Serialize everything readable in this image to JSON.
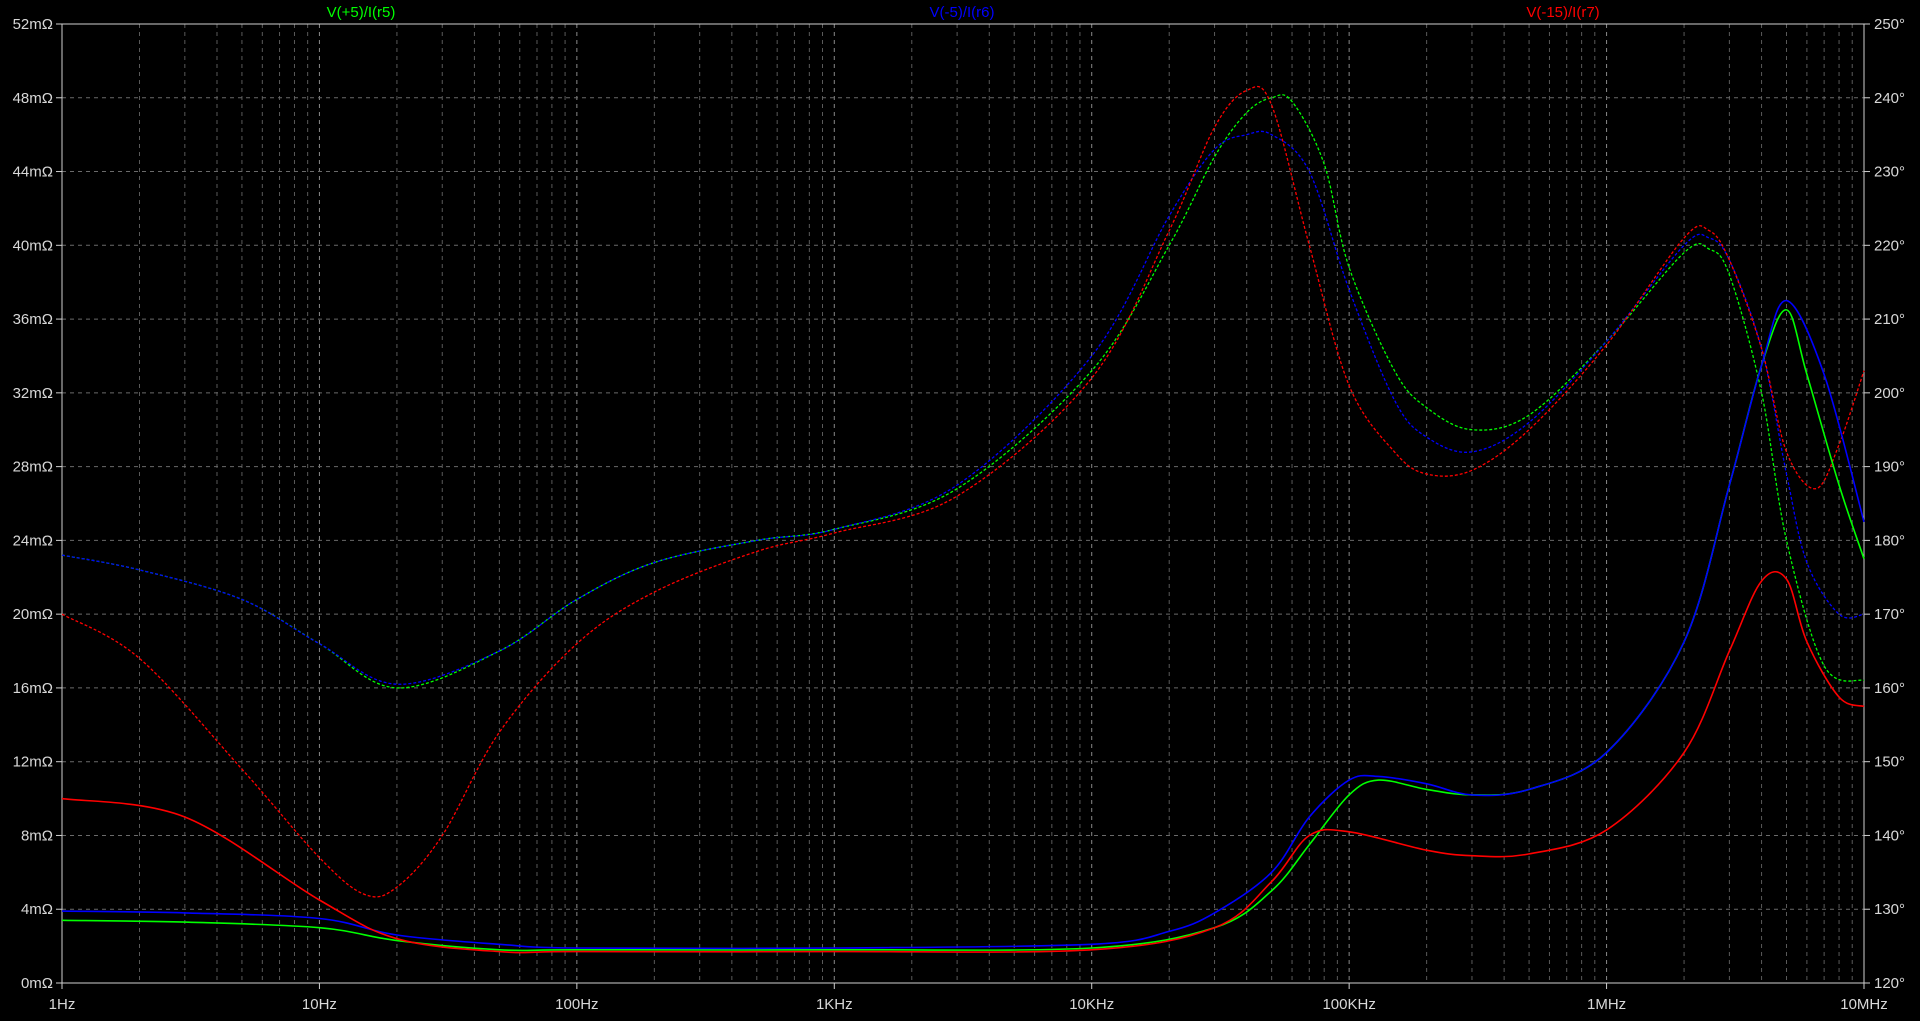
{
  "legend": [
    {
      "label": "V(+5)/I(r5)",
      "color": "#00ff00"
    },
    {
      "label": "V(-5)/I(r6)",
      "color": "#0000ff"
    },
    {
      "label": "V(-15)/I(r7)",
      "color": "#ff0000"
    }
  ],
  "chart_data": {
    "type": "line",
    "xscale": "log",
    "xlim": [
      1,
      10000000
    ],
    "x_ticks": [
      {
        "v": 1,
        "label": "1Hz"
      },
      {
        "v": 10,
        "label": "10Hz"
      },
      {
        "v": 100,
        "label": "100Hz"
      },
      {
        "v": 1000,
        "label": "1KHz"
      },
      {
        "v": 10000,
        "label": "10KHz"
      },
      {
        "v": 100000,
        "label": "100KHz"
      },
      {
        "v": 1000000,
        "label": "1MHz"
      },
      {
        "v": 10000000,
        "label": "10MHz"
      }
    ],
    "ylim_left": [
      0,
      52
    ],
    "y_ticks_left": [
      {
        "v": 0,
        "label": "0mΩ"
      },
      {
        "v": 4,
        "label": "4mΩ"
      },
      {
        "v": 8,
        "label": "8mΩ"
      },
      {
        "v": 12,
        "label": "12mΩ"
      },
      {
        "v": 16,
        "label": "16mΩ"
      },
      {
        "v": 20,
        "label": "20mΩ"
      },
      {
        "v": 24,
        "label": "24mΩ"
      },
      {
        "v": 28,
        "label": "28mΩ"
      },
      {
        "v": 32,
        "label": "32mΩ"
      },
      {
        "v": 36,
        "label": "36mΩ"
      },
      {
        "v": 40,
        "label": "40mΩ"
      },
      {
        "v": 44,
        "label": "44mΩ"
      },
      {
        "v": 48,
        "label": "48mΩ"
      },
      {
        "v": 52,
        "label": "52mΩ"
      }
    ],
    "ylim_right": [
      120,
      250
    ],
    "y_ticks_right": [
      {
        "v": 120,
        "label": "120°"
      },
      {
        "v": 130,
        "label": "130°"
      },
      {
        "v": 140,
        "label": "140°"
      },
      {
        "v": 150,
        "label": "150°"
      },
      {
        "v": 160,
        "label": "160°"
      },
      {
        "v": 170,
        "label": "170°"
      },
      {
        "v": 180,
        "label": "180°"
      },
      {
        "v": 190,
        "label": "190°"
      },
      {
        "v": 200,
        "label": "200°"
      },
      {
        "v": 210,
        "label": "210°"
      },
      {
        "v": 220,
        "label": "220°"
      },
      {
        "v": 230,
        "label": "230°"
      },
      {
        "v": 240,
        "label": "240°"
      },
      {
        "v": 250,
        "label": "250°"
      }
    ],
    "grid": true,
    "series": [
      {
        "name": "V(+5)/I(r5)",
        "kind": "magnitude",
        "axis": "left",
        "color": "#00ff00",
        "x": [
          1,
          3,
          10,
          20,
          50,
          100,
          1000,
          10000,
          30000,
          50000,
          70000,
          100000,
          130000,
          200000,
          300000,
          500000,
          1000000,
          2000000,
          3000000,
          4000000,
          5000000,
          6000000,
          8000000,
          10000000
        ],
        "y": [
          3.4,
          3.3,
          3.0,
          2.3,
          1.8,
          1.8,
          1.8,
          1.9,
          3.0,
          5.0,
          7.5,
          10.2,
          11.0,
          10.5,
          10.2,
          10.5,
          12.5,
          18.5,
          27.0,
          33.5,
          36.5,
          33.0,
          27.0,
          23.0
        ]
      },
      {
        "name": "V(-5)/I(r6)",
        "kind": "magnitude",
        "axis": "left",
        "color": "#0000ff",
        "x": [
          1,
          3,
          10,
          20,
          50,
          100,
          1000,
          10000,
          20000,
          30000,
          50000,
          70000,
          100000,
          130000,
          200000,
          300000,
          500000,
          1000000,
          2000000,
          3000000,
          4000000,
          5000000,
          7000000,
          10000000
        ],
        "y": [
          3.9,
          3.8,
          3.5,
          2.6,
          2.1,
          1.9,
          1.9,
          2.1,
          2.8,
          3.8,
          6.0,
          9.0,
          11.0,
          11.2,
          10.8,
          10.2,
          10.5,
          12.5,
          18.5,
          27.0,
          33.5,
          37.0,
          33.0,
          25.0
        ]
      },
      {
        "name": "V(-15)/I(r7)",
        "kind": "magnitude",
        "axis": "left",
        "color": "#ff0000",
        "x": [
          1,
          3,
          10,
          20,
          50,
          100,
          1000,
          10000,
          30000,
          50000,
          70000,
          100000,
          200000,
          300000,
          500000,
          1000000,
          2000000,
          3000000,
          4000000,
          5000000,
          6000000,
          8000000,
          10000000
        ],
        "y": [
          10.0,
          9.0,
          4.5,
          2.4,
          1.7,
          1.7,
          1.7,
          1.8,
          3.0,
          5.5,
          8.0,
          8.2,
          7.2,
          6.9,
          7.0,
          8.3,
          12.5,
          18.0,
          21.8,
          21.9,
          18.5,
          15.5,
          15.0
        ]
      },
      {
        "name": "V(+5)/I(r5)",
        "kind": "phase",
        "axis": "right",
        "color": "#00ff00",
        "x": [
          1,
          2,
          5,
          10,
          20,
          50,
          100,
          200,
          500,
          1000,
          3000,
          10000,
          20000,
          30000,
          40000,
          50000,
          60000,
          80000,
          100000,
          150000,
          200000,
          300000,
          500000,
          1000000,
          2000000,
          2500000,
          3000000,
          4000000,
          5000000,
          7000000,
          10000000
        ],
        "y": [
          178,
          176,
          172,
          166,
          160,
          165,
          172,
          177,
          180,
          181.5,
          187,
          203,
          220,
          232,
          238,
          240,
          239.5,
          231,
          217,
          203,
          198,
          195,
          197,
          207,
          219,
          219.5,
          216,
          200,
          180,
          163,
          161
        ]
      },
      {
        "name": "V(-5)/I(r6)",
        "kind": "phase",
        "axis": "right",
        "color": "#0000ff",
        "x": [
          1,
          2,
          5,
          10,
          20,
          50,
          100,
          200,
          500,
          1000,
          3000,
          10000,
          20000,
          30000,
          40000,
          50000,
          70000,
          100000,
          150000,
          200000,
          300000,
          500000,
          1000000,
          2000000,
          2500000,
          3000000,
          4000000,
          5000000,
          6000000,
          8000000,
          10000000
        ],
        "y": [
          178,
          176,
          172,
          166,
          160.5,
          165,
          172,
          177,
          180,
          181.5,
          187.5,
          205,
          224,
          233,
          235,
          235,
          230,
          214,
          199,
          194,
          192,
          196,
          207,
          220,
          221,
          218,
          206,
          189,
          177,
          170,
          170
        ]
      },
      {
        "name": "V(-15)/I(r7)",
        "kind": "phase",
        "axis": "right",
        "color": "#ff0000",
        "x": [
          1,
          2,
          5,
          10,
          15,
          20,
          30,
          50,
          100,
          200,
          500,
          1000,
          3000,
          10000,
          20000,
          30000,
          40000,
          50000,
          70000,
          100000,
          150000,
          200000,
          300000,
          500000,
          1000000,
          2000000,
          2500000,
          3000000,
          4000000,
          5000000,
          6500000,
          8000000,
          10000000
        ],
        "y": [
          170,
          164,
          149,
          137,
          132,
          133,
          140,
          154,
          166,
          173,
          178.5,
          181,
          186,
          202,
          222,
          236,
          241,
          239,
          220,
          201,
          192,
          189,
          189.5,
          195,
          206.5,
          221,
          222,
          218,
          206,
          192,
          187,
          193,
          203
        ]
      }
    ]
  }
}
